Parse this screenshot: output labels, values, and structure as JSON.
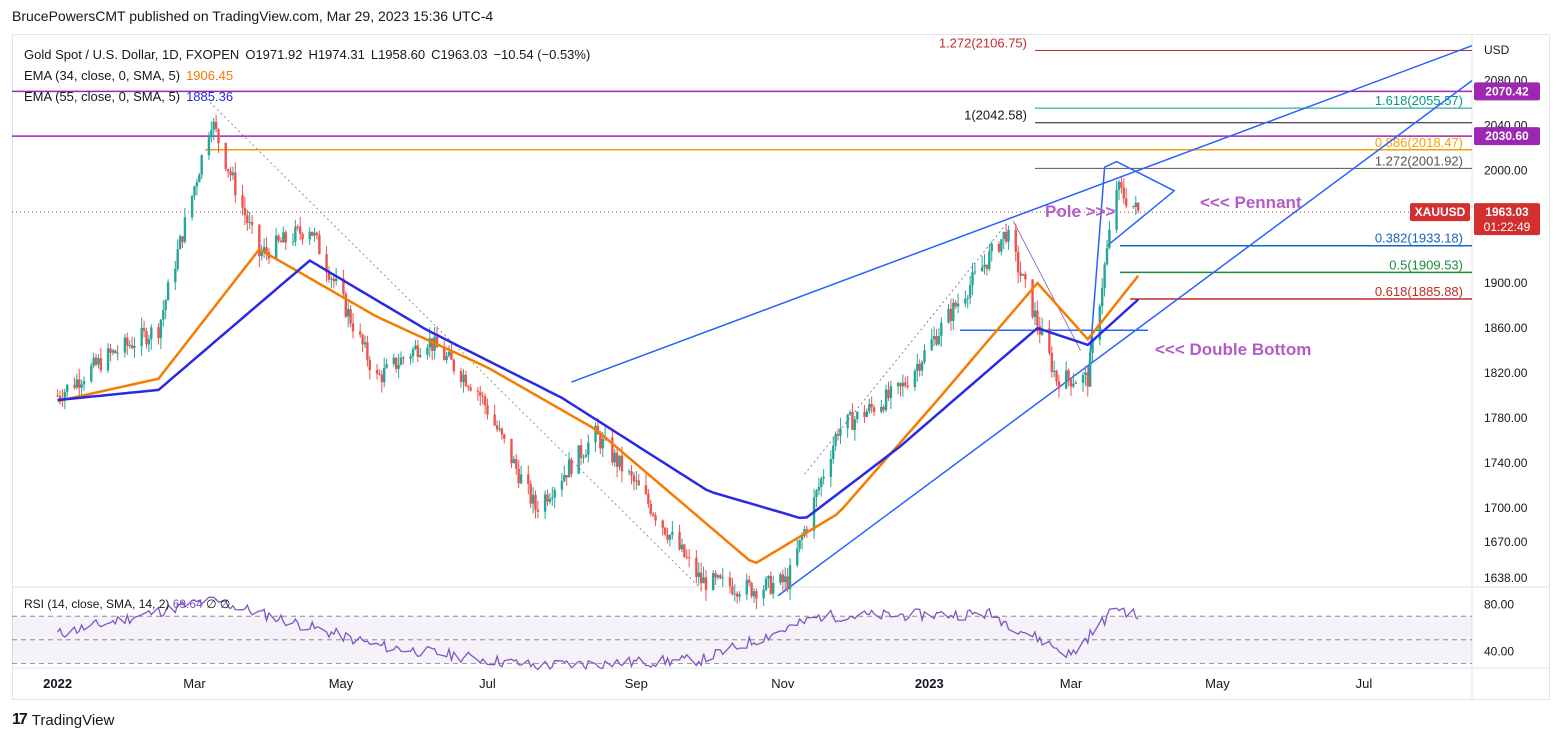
{
  "header": {
    "publisher": "BrucePowersCMT published on TradingView.com, Mar 29, 2023 15:36 UTC-4"
  },
  "legend": {
    "symbol_line": {
      "title": "Gold Spot / U.S. Dollar, 1D, FXOPEN",
      "o_label": "O",
      "o": "1971.92",
      "h_label": "H",
      "h": "1974.31",
      "l_label": "L",
      "l": "1958.60",
      "c_label": "C",
      "c": "1963.03",
      "change": "−10.54 (−0.53%)"
    },
    "ema34": {
      "label": "EMA (34, close, 0, SMA, 5)",
      "value": "1906.45",
      "color": "#f57c00"
    },
    "ema55": {
      "label": "EMA (55, close, 0, SMA, 5)",
      "value": "1885.36",
      "color": "#2929e6"
    }
  },
  "rsi_legend": {
    "label": "RSI (14, close, SMA, 14, 2)",
    "value": "69.64",
    "extra": "∅  ∅"
  },
  "footer": {
    "brand": "TradingView",
    "logo": "17"
  },
  "price_axis": {
    "unit": "USD",
    "ticks": [
      "2080.00",
      "2040.00",
      "2000.00",
      "1900.00",
      "1860.00",
      "1820.00",
      "1780.00",
      "1740.00",
      "1700.00",
      "1670.00",
      "1638.00"
    ],
    "badges": [
      {
        "text": "2070.42",
        "color": "#9c27b0"
      },
      {
        "text": "2030.60",
        "color": "#9c27b0"
      }
    ],
    "current": {
      "symbol": "XAUUSD",
      "price": "1963.03",
      "countdown": "01:22:49",
      "color": "#d32f2f"
    }
  },
  "rsi_axis": {
    "ticks": [
      "80.00",
      "40.00"
    ]
  },
  "time_axis": [
    "2022",
    "Mar",
    "May",
    "Jul",
    "Sep",
    "Nov",
    "2023",
    "Mar",
    "May",
    "Jul"
  ],
  "fib_labels": [
    {
      "text": "1.272(2106.75)",
      "color": "#c62828"
    },
    {
      "text": "1.618(2055.57)",
      "color": "#089981"
    },
    {
      "text": "1(2042.58)",
      "color": "#131722"
    },
    {
      "text": "0.886(2018.47)",
      "color": "#f59f00"
    },
    {
      "text": "1.272(2001.92)",
      "color": "#555555"
    },
    {
      "text": "0.382(1933.18)",
      "color": "#1565c0"
    },
    {
      "text": "0.5(1909.53)",
      "color": "#1b8a3a"
    },
    {
      "text": "0.618(1885.88)",
      "color": "#c62828"
    }
  ],
  "annotations": {
    "pole": "Pole >>>",
    "pennant": "<<< Pennant",
    "double_bottom": "<<< Double Bottom",
    "color": "#b35cc8"
  },
  "colors": {
    "up": "#26a69a",
    "down": "#ef5350",
    "trendline": "#2962ff",
    "level": "#9c27b0",
    "rsi": "#7e57c2"
  },
  "chart_data": {
    "type": "line",
    "title": "Gold Spot / U.S. Dollar, 1D, FXOPEN",
    "ylabel": "USD",
    "ylim": [
      1620,
      2110
    ],
    "series": [
      {
        "name": "Close",
        "x": [
          "2022-01-03",
          "2022-01-24",
          "2022-02-14",
          "2022-03-08",
          "2022-03-28",
          "2022-04-18",
          "2022-05-16",
          "2022-06-06",
          "2022-06-27",
          "2022-07-21",
          "2022-08-15",
          "2022-09-01",
          "2022-09-28",
          "2022-10-20",
          "2022-11-03",
          "2022-11-24",
          "2022-12-20",
          "2023-01-12",
          "2023-02-02",
          "2023-02-23",
          "2023-03-08",
          "2023-03-20",
          "2023-03-29"
        ],
        "values": [
          1800,
          1835,
          1860,
          2045,
          1925,
          1950,
          1815,
          1850,
          1805,
          1700,
          1765,
          1720,
          1635,
          1628,
          1635,
          1770,
          1805,
          1880,
          1945,
          1815,
          1815,
          1985,
          1963
        ]
      },
      {
        "name": "EMA (34, close, 0, SMA, 5)",
        "x": [
          "2022-01-03",
          "2022-02-14",
          "2022-03-28",
          "2022-05-16",
          "2022-07-01",
          "2022-08-15",
          "2022-10-20",
          "2022-11-24",
          "2023-01-02",
          "2023-02-15",
          "2023-03-08",
          "2023-03-29"
        ],
        "values": [
          1795,
          1815,
          1930,
          1870,
          1825,
          1770,
          1650,
          1695,
          1790,
          1900,
          1850,
          1906.45
        ]
      },
      {
        "name": "EMA (55, close, 0, SMA, 5)",
        "x": [
          "2022-01-03",
          "2022-02-14",
          "2022-04-18",
          "2022-06-06",
          "2022-08-01",
          "2022-10-01",
          "2022-11-10",
          "2022-12-20",
          "2023-02-15",
          "2023-03-08",
          "2023-03-29"
        ],
        "values": [
          1796,
          1805,
          1920,
          1858,
          1798,
          1715,
          1690,
          1755,
          1860,
          1845,
          1885.36
        ]
      }
    ],
    "horizontal_levels": [
      2106.75,
      2070.42,
      2055.57,
      2042.58,
      2030.6,
      2018.47,
      2001.92,
      1963.03,
      1933.18,
      1909.53,
      1885.88
    ],
    "rsi": {
      "ylim": [
        20,
        90
      ],
      "x": [
        "2022-01-03",
        "2022-03-08",
        "2022-05-16",
        "2022-07-21",
        "2022-09-28",
        "2022-11-17",
        "2023-01-26",
        "2023-03-01",
        "2023-03-20",
        "2023-03-29"
      ],
      "values": [
        55,
        84,
        45,
        28,
        33,
        70,
        72,
        37,
        78,
        69.64
      ]
    }
  }
}
